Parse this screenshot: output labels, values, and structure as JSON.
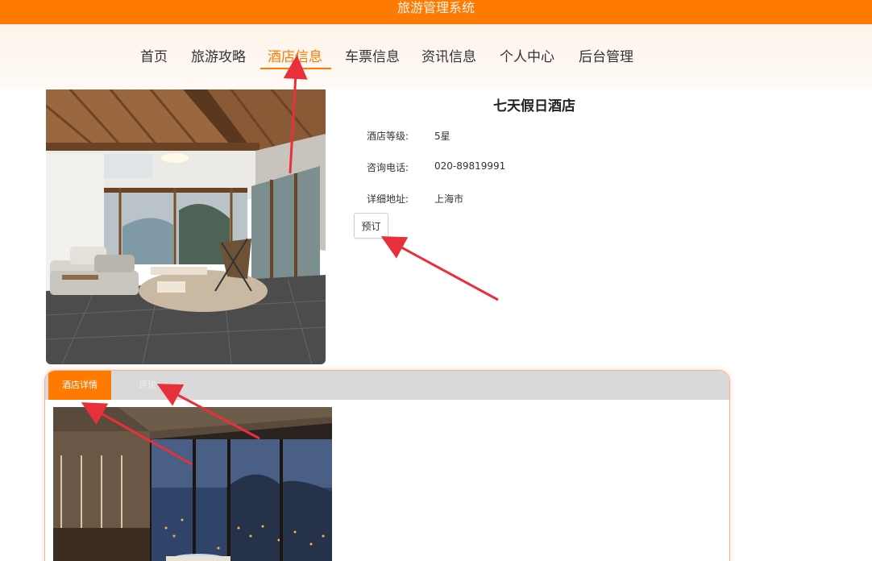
{
  "header": {
    "title": "旅游管理系统"
  },
  "nav": {
    "items": [
      {
        "label": "首页",
        "active": false
      },
      {
        "label": "旅游攻略",
        "active": false
      },
      {
        "label": "酒店信息",
        "active": true
      },
      {
        "label": "车票信息",
        "active": false
      },
      {
        "label": "资讯信息",
        "active": false
      },
      {
        "label": "个人中心",
        "active": false
      },
      {
        "label": "后台管理",
        "active": false
      }
    ]
  },
  "hotel": {
    "name": "七天假日酒店",
    "fields": [
      {
        "label": "酒店等级:",
        "value": "5星"
      },
      {
        "label": "咨询电话:",
        "value": "020-89819991"
      },
      {
        "label": "详细地址:",
        "value": "上海市"
      }
    ],
    "book_label": "预订"
  },
  "tabs": [
    {
      "label": "酒店详情",
      "active": true
    },
    {
      "label": "评论",
      "active": false
    }
  ],
  "colors": {
    "accent": "#ff7a00",
    "annotation": "#e8303a"
  }
}
